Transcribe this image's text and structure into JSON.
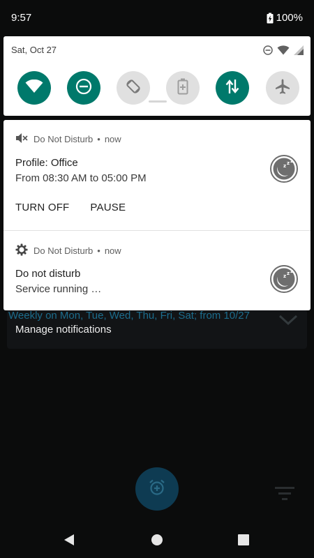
{
  "status_bar": {
    "time": "9:57",
    "battery": "100%",
    "icons": [
      "battery-charging-icon"
    ]
  },
  "quick_settings": {
    "date": "Sat, Oct 27",
    "status_icons": [
      "dnd-minus-icon",
      "wifi-icon",
      "cell-signal-icon"
    ],
    "tiles": [
      {
        "name": "wifi",
        "icon": "wifi-icon",
        "state": "on"
      },
      {
        "name": "do-not-disturb",
        "icon": "dnd-minus-icon",
        "state": "on"
      },
      {
        "name": "auto-rotate",
        "icon": "rotate-icon",
        "state": "off"
      },
      {
        "name": "battery-saver",
        "icon": "battery-plus-icon",
        "state": "off"
      },
      {
        "name": "mobile-data",
        "icon": "data-arrows-icon",
        "state": "on"
      },
      {
        "name": "airplane-mode",
        "icon": "airplane-icon",
        "state": "off"
      }
    ],
    "accent_color": "#00796b"
  },
  "notifications": [
    {
      "app": "Do Not Disturb",
      "separator": "•",
      "time": "now",
      "header_icon": "muted-speaker-icon",
      "title": "Profile: Office",
      "text": "From 08:30 AM to 05:00 PM",
      "large_icon": "sleep-moon-icon",
      "actions": [
        "TURN OFF",
        "PAUSE"
      ]
    },
    {
      "app": "Do Not Disturb",
      "separator": "•",
      "time": "now",
      "header_icon": "gear-icon",
      "title": "Do not disturb",
      "text": "Service running …",
      "large_icon": "sleep-moon-icon"
    }
  ],
  "background_app": {
    "schedule_text": "Weekly on Mon, Tue, Wed, Thu, Fri, Sat; from 10/27",
    "manage_label": "Manage notifications",
    "icons": [
      "chevron-down-icon",
      "add-alarm-icon",
      "filter-icon"
    ]
  },
  "nav_bar": {
    "icons": [
      "back-icon",
      "home-icon",
      "recents-icon"
    ]
  }
}
